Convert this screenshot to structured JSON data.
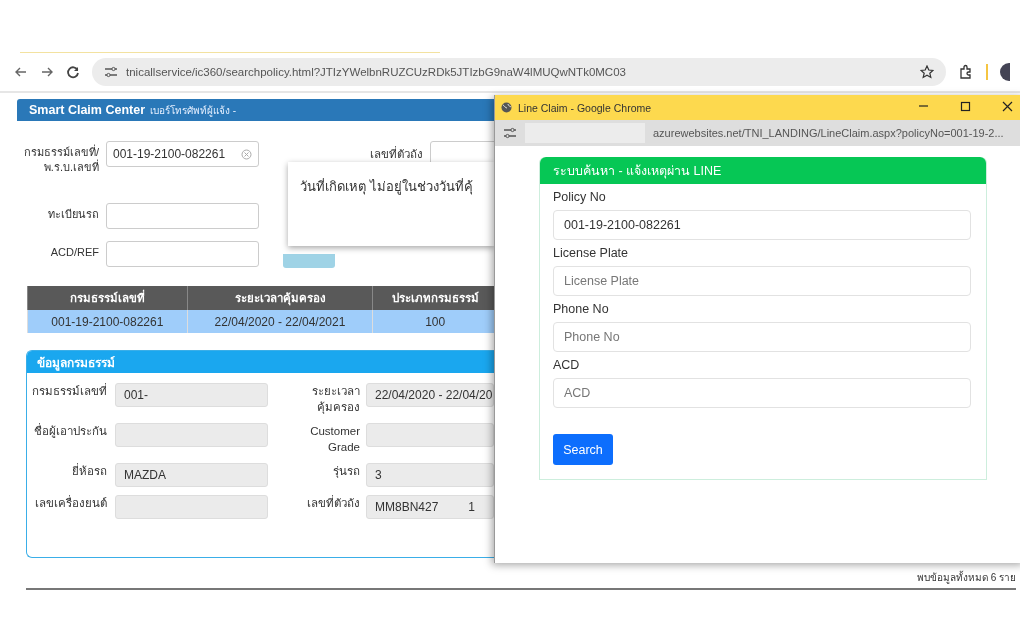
{
  "browser": {
    "url": "tnicallservice/ic360/searchpolicy.html?JTIzYWelbnRUZCUzRDk5JTIzbG9naW4lMUQwNTk0MC03"
  },
  "page": {
    "header": {
      "title": "Smart Claim Center",
      "subtitle": "เบอร์โทรศัพท์ผู้แจ้ง -"
    },
    "search_form": {
      "left_fields": [
        {
          "label": "กรมธรรม์เลขที่/พ.ร.บ.เลขที่",
          "value": "001-19-2100-082261",
          "clearable": true
        },
        {
          "label": "ทะเบียนรถ"
        },
        {
          "label": "ACD/REF"
        }
      ],
      "right_fields": [
        {
          "label": "เลขที่ตัวถัง"
        }
      ],
      "search_button": {
        "disabled": true
      }
    },
    "alert_dialog": {
      "message": "วันที่เกิดเหตุ ไม่อยู่ในช่วงวันที่คุ้"
    },
    "results_table": {
      "columns": [
        "กรมธรรม์เลขที่",
        "ระยะเวลาคุ้มครอง",
        "ประเภทกรมธรรม์"
      ],
      "rows": [
        {
          "cells": [
            "001-19-2100-082261",
            "22/04/2020 - 22/04/2021",
            "100"
          ],
          "selected": true
        }
      ]
    },
    "policy_info": {
      "title": "ข้อมูลกรมธรรม์",
      "rows": [
        {
          "left": {
            "label": "กรมธรรม์เลขที่",
            "value": "001-"
          },
          "right": {
            "label": "ระยะเวลาคุ้มครอง",
            "value": "22/04/2020 - 22/04/20"
          }
        },
        {
          "left": {
            "label": "ชื่อผู้เอาประกัน"
          },
          "right": {
            "label": "Customer Grade"
          }
        },
        {
          "left": {
            "label": "ยี่ห้อรถ",
            "value": "MAZDA"
          },
          "right": {
            "label": "รุ่นรถ",
            "value": "3"
          }
        },
        {
          "left": {
            "label": "เลขเครื่องยนต์"
          },
          "right": {
            "label": "เลขที่ตัวถัง",
            "value": "MM8BN427         1"
          }
        }
      ]
    },
    "footer": "พบข้อมูลทั้งหมด 6 ราย"
  },
  "popup": {
    "title": "Line Claim - Google Chrome",
    "url": "azurewebsites.net/TNI_LANDING/LineClaim.aspx?policyNo=001-19-2...",
    "form": {
      "title": "ระบบค้นหา - แจ้งเหตุผ่าน LINE",
      "fields": [
        {
          "label": "Policy No",
          "value": "001-19-2100-082261"
        },
        {
          "label": "License Plate",
          "placeholder": "License Plate"
        },
        {
          "label": "Phone No",
          "placeholder": "Phone No"
        },
        {
          "label": "ACD",
          "placeholder": "ACD"
        }
      ],
      "button": "Search"
    }
  }
}
